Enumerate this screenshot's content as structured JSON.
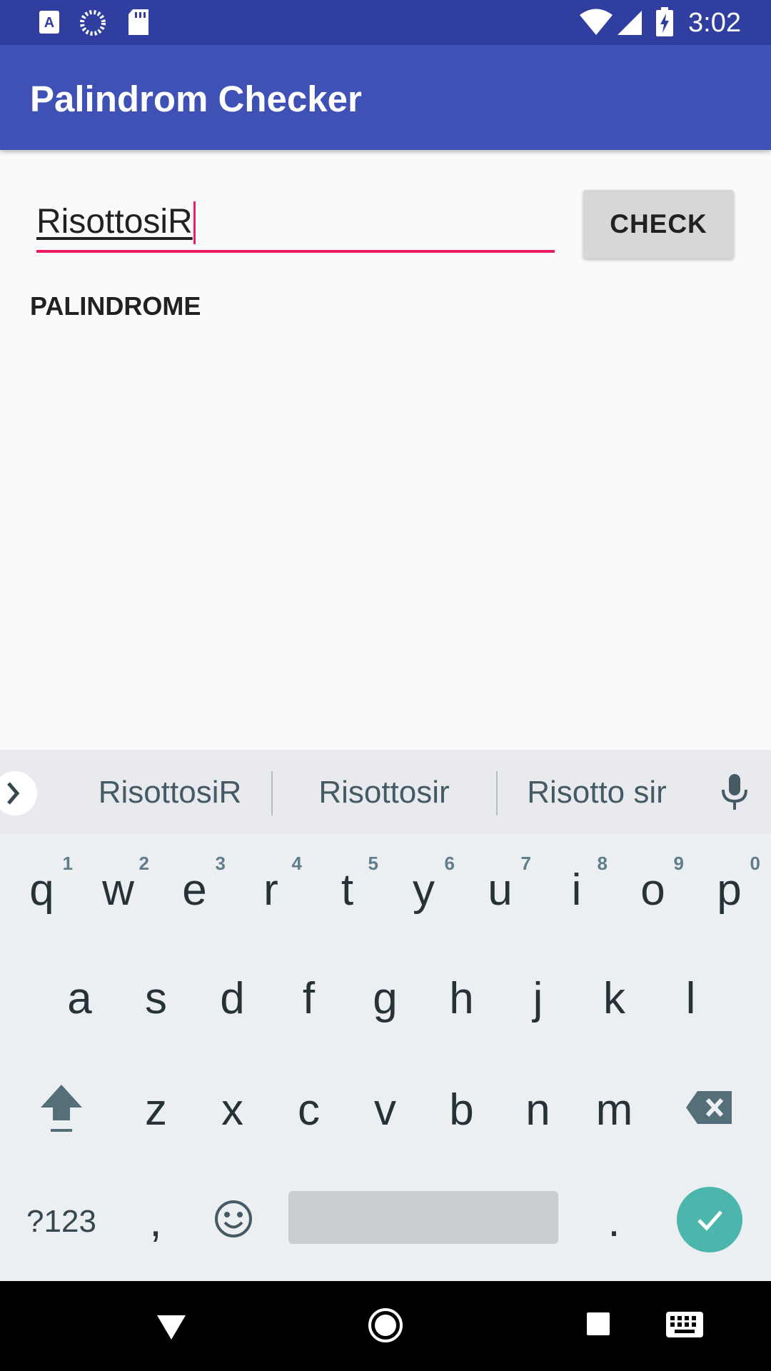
{
  "status_bar": {
    "time": "3:02",
    "icons": [
      "text-a-notification-icon",
      "sync-spinner-icon",
      "sd-card-icon",
      "wifi-icon",
      "cell-signal-icon",
      "battery-charging-icon"
    ]
  },
  "app_bar": {
    "title": "Palindrom Checker"
  },
  "form": {
    "input_value": "RisottosiR",
    "check_label": "CHECK",
    "result": "PALINDROME"
  },
  "keyboard": {
    "suggestions": [
      "RisottosiR",
      "Risottosir",
      "Risotto sir"
    ],
    "row1": [
      {
        "key": "q",
        "hint": "1"
      },
      {
        "key": "w",
        "hint": "2"
      },
      {
        "key": "e",
        "hint": "3"
      },
      {
        "key": "r",
        "hint": "4"
      },
      {
        "key": "t",
        "hint": "5"
      },
      {
        "key": "y",
        "hint": "6"
      },
      {
        "key": "u",
        "hint": "7"
      },
      {
        "key": "i",
        "hint": "8"
      },
      {
        "key": "o",
        "hint": "9"
      },
      {
        "key": "p",
        "hint": "0"
      }
    ],
    "row2": [
      "a",
      "s",
      "d",
      "f",
      "g",
      "h",
      "j",
      "k",
      "l"
    ],
    "row3": [
      "z",
      "x",
      "c",
      "v",
      "b",
      "n",
      "m"
    ],
    "symbols_label": "?123",
    "comma_label": ",",
    "period_label": "."
  },
  "colors": {
    "status_bar": "#303f9f",
    "app_bar": "#3f51b5",
    "accent": "#e91e63",
    "done_key": "#4db6ac"
  }
}
